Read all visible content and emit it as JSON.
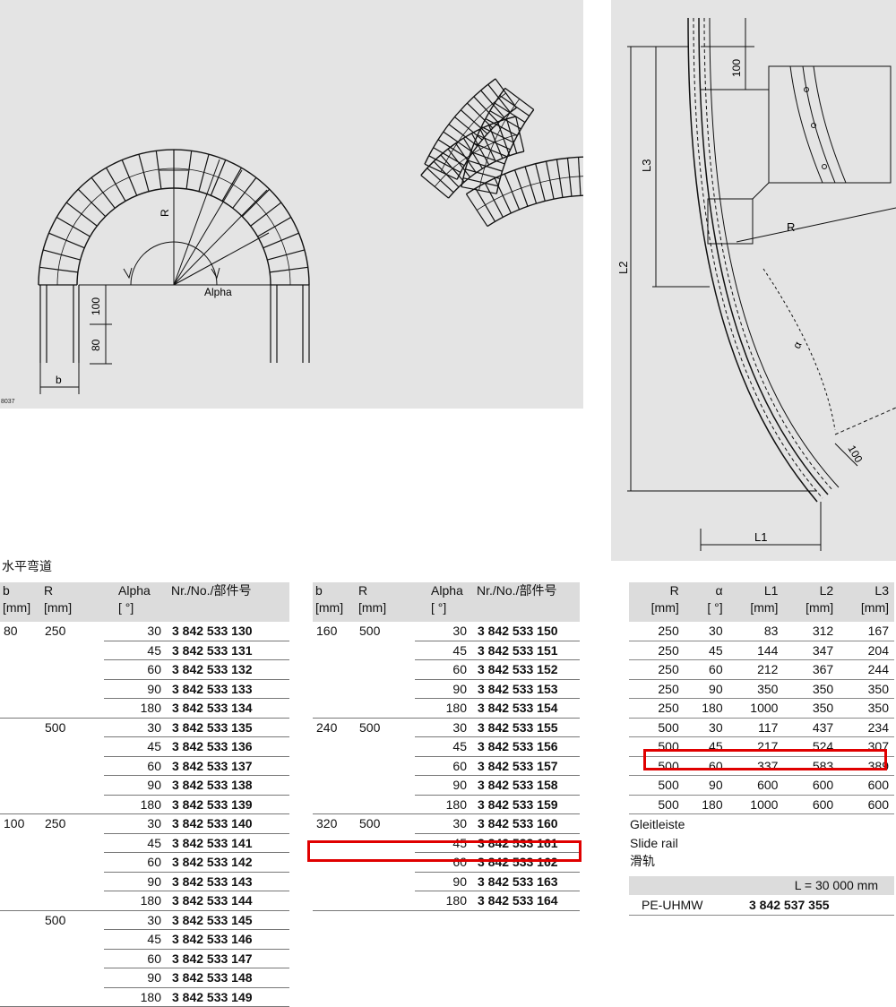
{
  "figure_left": {
    "id": "8037",
    "labels": {
      "radius": "R",
      "angle": "Alpha",
      "dim_upper": "100",
      "dim_lower": "80",
      "width": "b"
    }
  },
  "figure_right": {
    "labels": {
      "top_dim": "100",
      "l3": "L3",
      "radius": "R",
      "l2": "L2",
      "alpha": "α",
      "bottom_dim": "100",
      "l1": "L1"
    }
  },
  "section_title": "水平弯道",
  "table_left": {
    "headers": {
      "b": [
        "b",
        "[mm]"
      ],
      "r": [
        "R",
        "[mm]"
      ],
      "alpha": [
        "Alpha",
        "[ °]"
      ],
      "part": "Nr./No./部件号"
    },
    "groups": [
      {
        "b": "80",
        "r": "250",
        "rows": [
          [
            "30",
            "3 842 533 130"
          ],
          [
            "45",
            "3 842 533 131"
          ],
          [
            "60",
            "3 842 533 132"
          ],
          [
            "90",
            "3 842 533 133"
          ],
          [
            "180",
            "3 842 533 134"
          ]
        ]
      },
      {
        "b": "",
        "r": "500",
        "rows": [
          [
            "30",
            "3 842 533 135"
          ],
          [
            "45",
            "3 842 533 136"
          ],
          [
            "60",
            "3 842 533 137"
          ],
          [
            "90",
            "3 842 533 138"
          ],
          [
            "180",
            "3 842 533 139"
          ]
        ]
      },
      {
        "b": "100",
        "r": "250",
        "rows": [
          [
            "30",
            "3 842 533 140"
          ],
          [
            "45",
            "3 842 533 141"
          ],
          [
            "60",
            "3 842 533 142"
          ],
          [
            "90",
            "3 842 533 143"
          ],
          [
            "180",
            "3 842 533 144"
          ]
        ]
      },
      {
        "b": "",
        "r": "500",
        "rows": [
          [
            "30",
            "3 842 533 145"
          ],
          [
            "45",
            "3 842 533 146"
          ],
          [
            "60",
            "3 842 533 147"
          ],
          [
            "90",
            "3 842 533 148"
          ],
          [
            "180",
            "3 842 533 149"
          ]
        ]
      }
    ]
  },
  "table_mid": {
    "headers": {
      "b": [
        "b",
        "[mm]"
      ],
      "r": [
        "R",
        "[mm]"
      ],
      "alpha": [
        "Alpha",
        "[ °]"
      ],
      "part": "Nr./No./部件号"
    },
    "groups": [
      {
        "b": "160",
        "r": "500",
        "rows": [
          [
            "30",
            "3 842 533 150"
          ],
          [
            "45",
            "3 842 533 151"
          ],
          [
            "60",
            "3 842 533 152"
          ],
          [
            "90",
            "3 842 533 153"
          ],
          [
            "180",
            "3 842 533 154"
          ]
        ]
      },
      {
        "b": "240",
        "r": "500",
        "rows": [
          [
            "30",
            "3 842 533 155"
          ],
          [
            "45",
            "3 842 533 156"
          ],
          [
            "60",
            "3 842 533 157"
          ],
          [
            "90",
            "3 842 533 158"
          ],
          [
            "180",
            "3 842 533 159"
          ]
        ]
      },
      {
        "b": "320",
        "r": "500",
        "rows": [
          [
            "30",
            "3 842 533 160"
          ],
          [
            "45",
            "3 842 533 161"
          ],
          [
            "60",
            "3 842 533 162"
          ],
          [
            "90",
            "3 842 533 163"
          ],
          [
            "180",
            "3 842 533 164"
          ]
        ]
      }
    ],
    "highlighted_part": "3 842 533 162"
  },
  "table_dims": {
    "headers": [
      [
        "R",
        "[mm]"
      ],
      [
        "α",
        "[ °]"
      ],
      [
        "L1",
        "[mm]"
      ],
      [
        "L2",
        "[mm]"
      ],
      [
        "L3",
        "[mm]"
      ]
    ],
    "rows": [
      [
        "250",
        "30",
        "83",
        "312",
        "167"
      ],
      [
        "250",
        "45",
        "144",
        "347",
        "204"
      ],
      [
        "250",
        "60",
        "212",
        "367",
        "244"
      ],
      [
        "250",
        "90",
        "350",
        "350",
        "350"
      ],
      [
        "250",
        "180",
        "1000",
        "350",
        "350"
      ],
      [
        "500",
        "30",
        "117",
        "437",
        "234"
      ],
      [
        "500",
        "45",
        "217",
        "524",
        "307"
      ],
      [
        "500",
        "60",
        "337",
        "583",
        "389"
      ],
      [
        "500",
        "90",
        "600",
        "600",
        "600"
      ],
      [
        "500",
        "180",
        "1000",
        "600",
        "600"
      ]
    ],
    "highlighted_row": 7
  },
  "slide_rail": {
    "labels": [
      "Gleitleiste",
      "Slide rail",
      "滑轨"
    ],
    "length_header": "L = 30 000 mm",
    "material": "PE-UHMW",
    "part": "3 842 537 355"
  },
  "colors": {
    "panel": "#e4e4e4",
    "header": "#dcdcdc",
    "highlight": "#e00000"
  }
}
